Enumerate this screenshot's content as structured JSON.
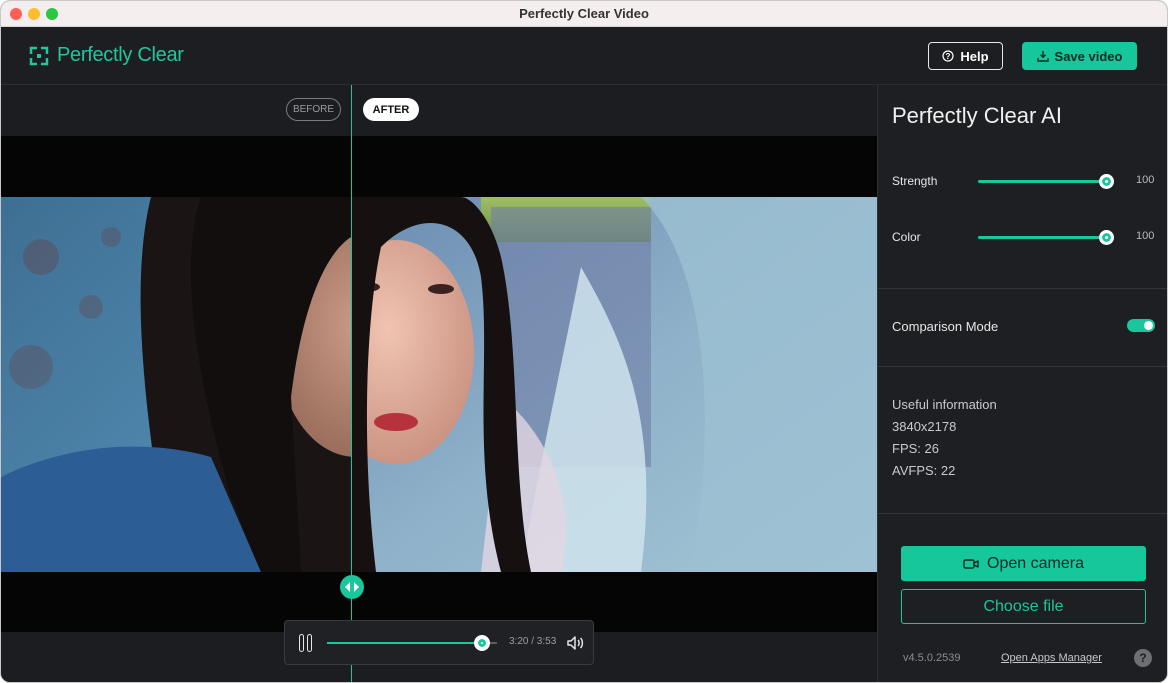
{
  "window": {
    "title": "Perfectly Clear Video"
  },
  "app": {
    "logo_text": "Perfectly Clear"
  },
  "header": {
    "help_label": "Help",
    "save_label": "Save video"
  },
  "preview": {
    "before_label": "BEFORE",
    "after_label": "AFTER",
    "split_position": 0.4
  },
  "player": {
    "time": "3:20 / 3:53",
    "progress": 0.91
  },
  "sidebar": {
    "title": "Perfectly Clear AI",
    "sliders": [
      {
        "label": "Strength",
        "value": "100",
        "fraction": 1.0
      },
      {
        "label": "Color",
        "value": "100",
        "fraction": 1.0
      }
    ],
    "comparison_label": "Comparison Mode",
    "comparison_on": true,
    "info": {
      "heading": "Useful information",
      "resolution": "3840x2178",
      "fps": "FPS: 26",
      "avfps": "AVFPS: 22"
    },
    "open_camera_label": "Open camera",
    "choose_file_label": "Choose file",
    "version": "v4.5.0.2539",
    "apps_manager_label": "Open Apps Manager",
    "help_glyph": "?"
  },
  "colors": {
    "accent": "#17c79c",
    "panel": "#1e1f22",
    "background": "#1b1c1f"
  },
  "icons": [
    "logo-icon",
    "help-circle-icon",
    "download-icon",
    "pause-icon",
    "volume-icon",
    "camera-icon",
    "split-handle-icon"
  ]
}
